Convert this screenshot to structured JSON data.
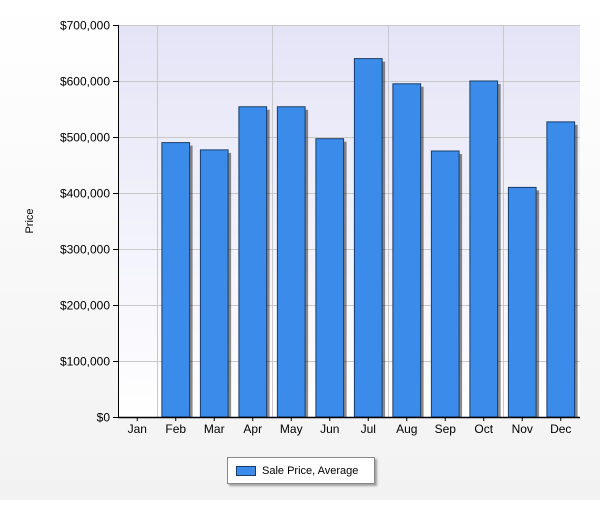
{
  "chart_data": {
    "type": "bar",
    "title": "",
    "xlabel": "",
    "ylabel": "Price",
    "categories": [
      "Jan",
      "Feb",
      "Mar",
      "Apr",
      "May",
      "Jun",
      "Jul",
      "Aug",
      "Sep",
      "Oct",
      "Nov",
      "Dec"
    ],
    "series": [
      {
        "name": "Sale Price, Average",
        "values": [
          0,
          490000,
          477000,
          554000,
          554000,
          497000,
          640000,
          595000,
          475000,
          600000,
          410000,
          527000
        ]
      }
    ],
    "ylim": [
      0,
      700000
    ],
    "yticks": [
      0,
      100000,
      200000,
      300000,
      400000,
      500000,
      600000,
      700000
    ],
    "ytick_labels": [
      "$0",
      "$100,000",
      "$200,000",
      "$300,000",
      "$400,000",
      "$500,000",
      "$600,000",
      "$700,000"
    ],
    "grid": true,
    "legend_position": "bottom-center",
    "colors": {
      "bar_fill": "#3b8bea",
      "bar_stroke": "#1a3d66",
      "plot_bg_top": "#e4e4f7",
      "plot_bg_bottom": "#ffffff",
      "grid": "#c8c8c8"
    }
  }
}
